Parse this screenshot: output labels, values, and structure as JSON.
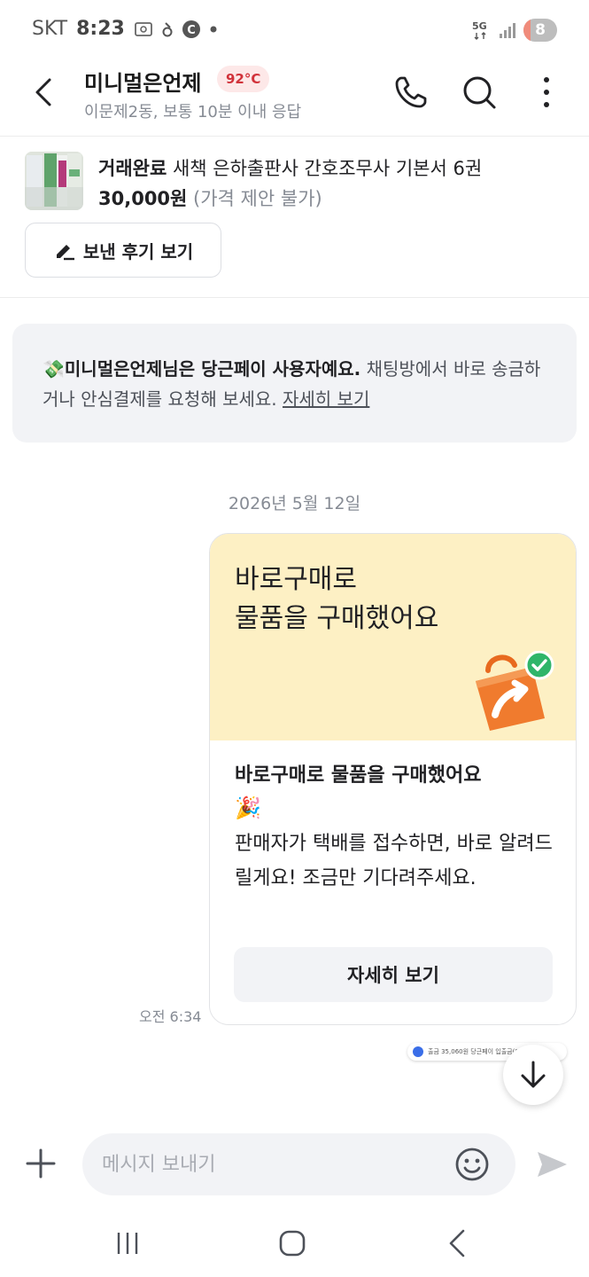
{
  "status_bar": {
    "carrier": "SKT",
    "time": "8:23",
    "network": "5G",
    "battery": "8"
  },
  "header": {
    "name": "미니멀은언제",
    "temperature": "92°C",
    "subtitle": "이문제2동, 보통 10분 이내 응답"
  },
  "product": {
    "status": "거래완료",
    "title": "새책 은하출판사 간호조무사 기본서 6권",
    "price": "30,000원",
    "negotiation": "(가격 제안 불가)",
    "review_button": "보낸 후기 보기"
  },
  "notice": {
    "emoji": "💸",
    "bold_text": "미니멀은언제님은 당근페이 사용자예요.",
    "text": " 채팅방에서 바로 송금하거나 안심결제를 요청해 보세요. ",
    "link": "자세히 보기"
  },
  "date_divider": "2026년 5월 12일",
  "message": {
    "banner_title": "바로구매로\n물품을 구매했어요",
    "heading": "바로구매로 물품을 구매했어요",
    "emoji": "🎉",
    "body": "판매자가 택배를 접수하면, 바로 알려드릴게요! 조금만 기다려주세요.",
    "button": "자세히 보기",
    "time": "오전 6:34"
  },
  "notification_chip": {
    "text": "출금 35,060원 당근페이 입출금(8456)"
  },
  "input": {
    "placeholder": "메시지 보내기"
  },
  "colors": {
    "temperature_bg": "#fde8e8",
    "temperature_text": "#d1323a",
    "banner_bg": "#fdf0c4",
    "bag_orange": "#f07b2e",
    "check_green": "#2fb56a"
  }
}
